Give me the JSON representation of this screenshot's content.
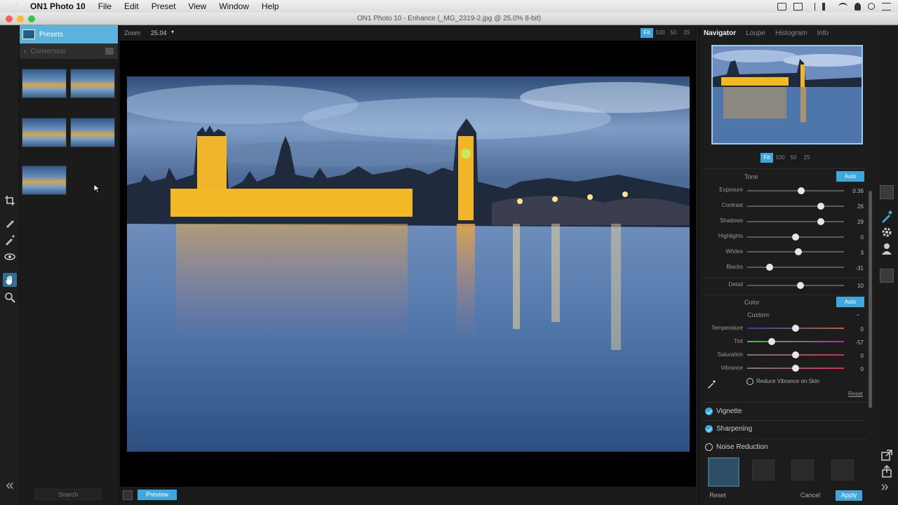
{
  "menubar": {
    "app_name": "ON1 Photo 10",
    "items": [
      "File",
      "Edit",
      "Preset",
      "View",
      "Window",
      "Help"
    ]
  },
  "window": {
    "title": "ON1 Photo 10 - Enhance (_MG_2319-2.jpg @ 25.0% 8-bit)"
  },
  "presets_panel": {
    "header": "Presets",
    "category": "Conversion",
    "search_placeholder": "Search"
  },
  "canvas": {
    "zoom_label": "Zoom",
    "zoom_value": "25.04",
    "view_modes": [
      "Fit",
      "100",
      "50",
      "25"
    ],
    "preview_button": "Preview"
  },
  "right_panel": {
    "tabs": [
      "Navigator",
      "Loupe",
      "Histogram",
      "Info"
    ],
    "nav_zoom_modes": [
      "Fit",
      "100",
      "50",
      "25"
    ],
    "tone": {
      "title": "Tone",
      "auto": "Auto",
      "sliders": [
        {
          "label": "Exposure",
          "value": "0.36",
          "pos": 0.56
        },
        {
          "label": "Contrast",
          "value": "26",
          "pos": 0.76
        },
        {
          "label": "Shadows",
          "value": "29",
          "pos": 0.76
        },
        {
          "label": "Highlights",
          "value": "0",
          "pos": 0.5
        },
        {
          "label": "Whites",
          "value": "3",
          "pos": 0.53
        },
        {
          "label": "Blacks",
          "value": "-31",
          "pos": 0.23
        }
      ],
      "detail": {
        "label": "Detail",
        "value": "10",
        "pos": 0.55
      }
    },
    "color": {
      "title": "Color",
      "auto": "Auto",
      "mode": "Custom",
      "sliders": [
        {
          "label": "Temperature",
          "value": "0",
          "pos": 0.5
        },
        {
          "label": "Tint",
          "value": "-57",
          "pos": 0.25
        },
        {
          "label": "Saturation",
          "value": "0",
          "pos": 0.5
        },
        {
          "label": "Vibrance",
          "value": "0",
          "pos": 0.5
        }
      ],
      "skin_option": "Reduce Vibrance on Skin",
      "reset_link": "Reset"
    },
    "sections": [
      {
        "label": "Vignette",
        "checked": true
      },
      {
        "label": "Sharpening",
        "checked": true
      },
      {
        "label": "Noise Reduction",
        "checked": false
      }
    ],
    "footer": {
      "reset": "Reset",
      "cancel": "Cancel",
      "apply": "Apply"
    }
  },
  "colors": {
    "accent": "#3fa7dc",
    "background": "#1c1c1c"
  }
}
